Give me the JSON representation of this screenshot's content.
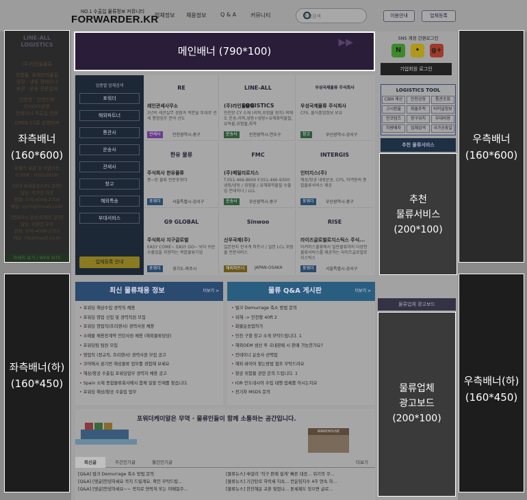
{
  "header": {
    "tagline": "NO.1 수출입 물류정보 커뮤니티",
    "logo": "FORWARDER.KR",
    "nav": [
      "업체정보",
      "채용정보",
      "Q & A",
      "커뮤니티"
    ],
    "search_placeholder": "통합검색",
    "btn_info": "이용안내",
    "btn_register": "업체등록"
  },
  "banners": {
    "main": "메인배너 (790*100)",
    "left_top_line1": "좌측배너",
    "left_top_line2": "(160*600)",
    "left_bottom_line1": "좌측배너(하)",
    "left_bottom_line2": "(160*450)",
    "right_top_line1": "우측배너",
    "right_top_line2": "(160*600)",
    "right_bottom_line1": "우측배너(하)",
    "right_bottom_line2": "(160*450)",
    "rec_line1": "추천",
    "rec_line2": "물류서비스",
    "rec_line3": "(200*100)",
    "ad_line1": "물류업체",
    "ad_line2": "광고보드",
    "ad_line3": "(200*100)"
  },
  "left_ad_text": {
    "company": "(주)라인올물류",
    "lines": [
      "위험물, 유해화학물질",
      "냉장 · 냉동 컨테이너",
      "보관 · 운송 전문업체",
      "인천항 · 인천신항",
      "CY/CFS운영",
      "컨테이너 적출입 전문",
      "OPEN CY로 운영되며",
      "화물의 보관 및 작업가능",
      "(CODE : 02012019)",
      "[국내 보세운송/CFS 문의]",
      "담당: 박의진 차장",
      "전화: 070-4008-2704",
      "메일: cycfs@lineall.co.kr",
      "[컨테이너 운송/트럭킹 문의]",
      "담당: 이현진 부장",
      "전화: 070-4008-2753",
      "메일: rfq@lineall.co.kr",
      "자세히 보기 / WEB SITE"
    ]
  },
  "directory": {
    "title": "업종별 업체검색",
    "buttons": [
      "포워더",
      "해외파트너",
      "통관사",
      "운송사",
      "관세사",
      "창고",
      "해외특송",
      "부대서비스"
    ],
    "register": "업체등록 안내"
  },
  "companies": [
    {
      "logo": "RE",
      "name": "레인관세사무소",
      "desc": "3년의 세관실무 경험과 학문을 토대로 관세 행정업무 분야 선도",
      "tag": "관세사",
      "tag_color": "#6a3a8a",
      "loc": "인천광역시-중구"
    },
    {
      "logo": "LINE-ALL LOGISTICS",
      "name": "(주)라인올물류",
      "desc": "인천항 CY 소재 (리퍼,위험물 장치) 외에도 운송,리퍼,냉동+냉장+유해화학물질,유독물,위험물,화학",
      "tag": "운송사",
      "tag_color": "#2f5a3a",
      "loc": "인천광역시-연수구"
    },
    {
      "logo": "우성국제물류 주식회사",
      "name": "우성국제물류 주식회사",
      "desc": "CFS, 물식품업정보 보유",
      "tag": "창고",
      "tag_color": "#2f5a3a",
      "loc": "부산광역시-강서구"
    },
    {
      "logo": "한유 물류",
      "name": "주식회사 한유물류",
      "desc": "중~한 물류 전문포워더",
      "tag": "포워더",
      "tag_color": "#2a4a6a",
      "loc": "서울특별시-강서구"
    },
    {
      "logo": "FMC",
      "name": "(주)패밀리로지스",
      "desc": "T.051-466-8600 F.051-466-9300 냉장/냉동 / 위험물 / 유해화학물질 수출입 컨테이너 / LCL",
      "tag": "운송사",
      "tag_color": "#2f5a3a",
      "loc": "부산광역시-중구"
    },
    {
      "logo": "INTERGIS",
      "name": "인터지스(주)",
      "desc": "해상/항공 내륙운송, CFS, 하역등의 종합물류서비스 제공",
      "tag": "포워더",
      "tag_color": "#2a4a6a",
      "loc": "부산광역시-중구"
    },
    {
      "logo": "G9 GLOBAL",
      "name": "주식회사 지구글로벌",
      "desc": "EASY COME~ EASY GO~ 보다 쉬운 수출입을 지향하는 복합물류기업",
      "tag": "포워더",
      "tag_color": "#2a4a6a",
      "loc": "경기도-파주시"
    },
    {
      "logo": "Sinwoo",
      "name": "신우국제(주)",
      "desc": "일본현지 한국계 파트너 / 일본 LCL 위험물 전문서비스",
      "tag": "해외파트너",
      "tag_color": "#6a5a1a",
      "loc": "JAPAN-OSAKA"
    },
    {
      "logo": "RISE",
      "name": "라이즈글로벌로지스틱스 주식...",
      "desc": "이커머스물류에서 일반물류까지 다양한 물류서비스를 제공하는 라이즈글로벌로지스틱스",
      "tag": "포워더",
      "tag_color": "#2a4a6a",
      "loc": "서울특별시-강서구"
    }
  ],
  "jobs": {
    "title": "최신 물류채용 정보",
    "more": "더보기 >",
    "items": [
      "포워딩 해상수입 경력직 채용",
      "포워딩 영업 신입 및 경력직원 모집",
      "포워딩 영업직(프리랜서) 경력사원 채용",
      "소매물 채용전계약 인턴사원 채용 (해외물류담당)",
      "포워딩팀 팀원 모집",
      "영업직 (정규직, 프리랜서) 경력사원 모집 공고",
      "코어에서 꿈기반 해상물류 업무를 경험해 보세요",
      "해상/항공 수출입 포워딩업무 경력자 채용 공고",
      "Spain 소재 종합물류회사에서 함께 일할 인재를 찾습니다.",
      "포워딩 해상/항공 수출입 업무"
    ]
  },
  "qa": {
    "title": "물류 Q&A 게시판",
    "more": "더보기 >",
    "items": [
      "벌크 Demurrage 축소 방법 문의",
      "위해 -> 인천항 40ft 2",
      "화물운송업허가",
      "인천 구항 창고 소개 부탁드립니다. 1",
      "해외OEM 생산 후 국내판매 시 판매 가능한가요?",
      "컨테이너 운송사 선택업",
      "해외 바이어 찾는방법 협조 부탁드려요",
      "항공 위험물 관련 문의 드립니다. 1",
      "IOR 인도네시아 수입 대행 업체를 아시는지요",
      "전기차 MSDS 문의"
    ]
  },
  "community": {
    "title": "포워더케이알은 무역 · 물류인들이 함께 소통하는 공간입니다.",
    "warehouse": "WAREHOUSE",
    "tabs": [
      "최신글",
      "주간인기글",
      "월간인기글"
    ],
    "more": "더보기",
    "left": [
      "[Q&A] 벌크 Demurrage 축소 방법 문의",
      "[Q&A] [댓글]안녕하세요 꼭지 드릴게요. 확인 부탁드립...",
      "[Q&A] [댓글]안녕하세요~~ 꼭지로 연락처 또는 이메일주..."
    ],
    "right": [
      "[물류뉴스] 中알리 '직구 판매 쉼게' 빠른 대응... 위기의 쿠...",
      "[물류뉴스] 기간탄로 하락세 지속... 컨운임지수 4주 연속 하...",
      "[물류뉴스] 한진해운 교훈 잊었나... 톤세제도 잇으면 글로..."
    ]
  },
  "right": {
    "sns_title": "SNS 계정 간편로그인",
    "sns": [
      {
        "label": "N",
        "color": "#3c8a2a"
      },
      {
        "label": "•",
        "color": "#b09818"
      },
      {
        "label": "g+",
        "color": "#a03a2a"
      }
    ],
    "member_login": "기업회원 로그인",
    "ltool_title": "LOGISTICS TOOL",
    "ltool": [
      "CBM 계산",
      "인천공항",
      "통관조회",
      "고시환율",
      "화물추적",
      "터미널정보",
      "인코텀즈",
      "항구위치",
      "부대비용",
      "차량배차",
      "업체검색",
      "국가공휴일"
    ],
    "rec_head": "추천 물류서비스",
    "adboard_head": "물류업체 광고보드"
  }
}
